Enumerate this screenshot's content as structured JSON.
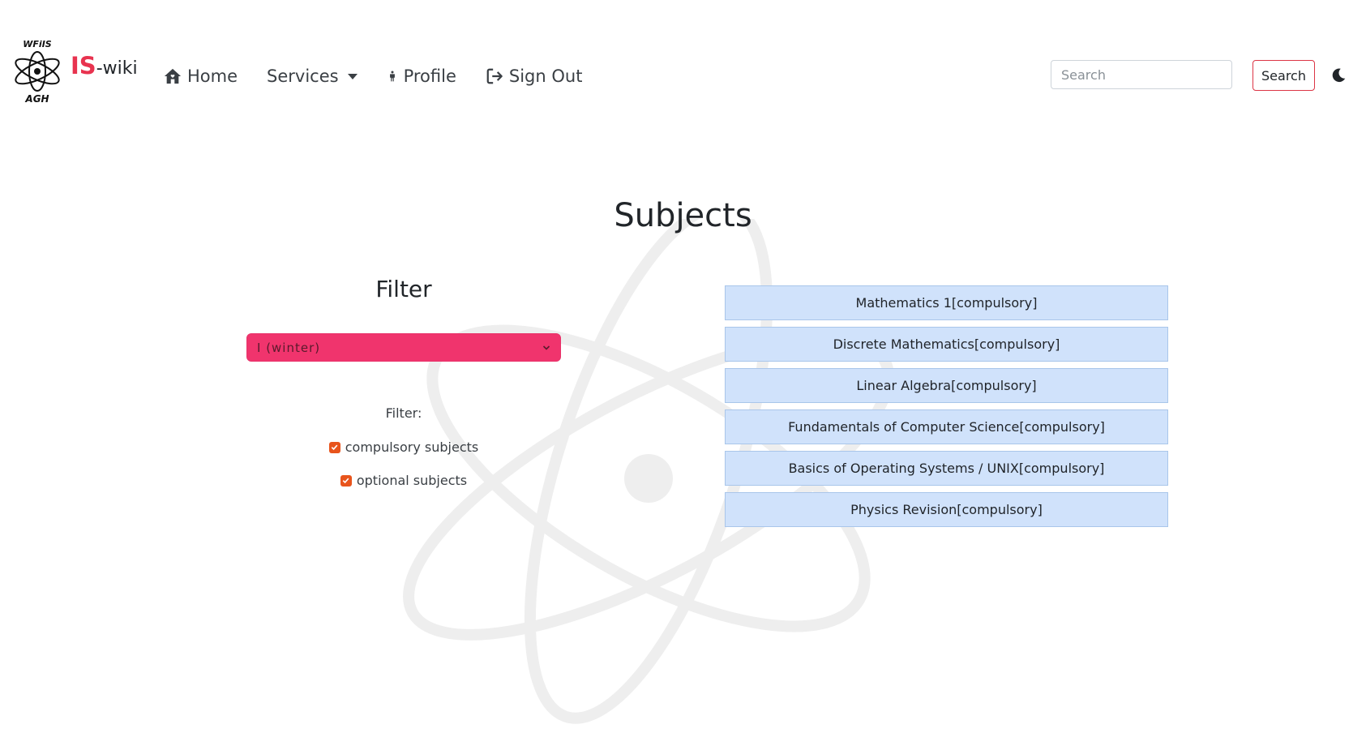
{
  "navbar": {
    "brand": {
      "logo_top_text": "WFiIS",
      "logo_bottom_text": "AGH",
      "is_text": "IS",
      "wiki_text": "-wiki"
    },
    "links": {
      "home": "Home",
      "services": "Services",
      "profile": "Profile",
      "sign_out": "Sign Out"
    },
    "search": {
      "placeholder": "Search",
      "button_label": "Search"
    },
    "theme_toggle_icon": "moon-icon"
  },
  "main": {
    "title": "Subjects",
    "filter": {
      "title": "Filter",
      "semester_selected": "I (winter)",
      "label": "Filter:",
      "checkboxes": [
        {
          "label": "compulsory subjects",
          "checked": true
        },
        {
          "label": "optional subjects",
          "checked": true
        }
      ]
    },
    "subjects": [
      {
        "label": "Mathematics 1[compulsory]"
      },
      {
        "label": "Discrete Mathematics[compulsory]"
      },
      {
        "label": "Linear Algebra[compulsory]"
      },
      {
        "label": "Fundamentals of Computer Science[compulsory]"
      },
      {
        "label": "Basics of Operating Systems / UNIX[compulsory]"
      },
      {
        "label": "Physics Revision[compulsory]"
      }
    ]
  },
  "colors": {
    "brand_accent": "#e8334f",
    "select_background": "#f0346d",
    "checkbox": "#e8541c",
    "subject_background": "#d0e2fb",
    "search_button_border": "#dc3545"
  }
}
